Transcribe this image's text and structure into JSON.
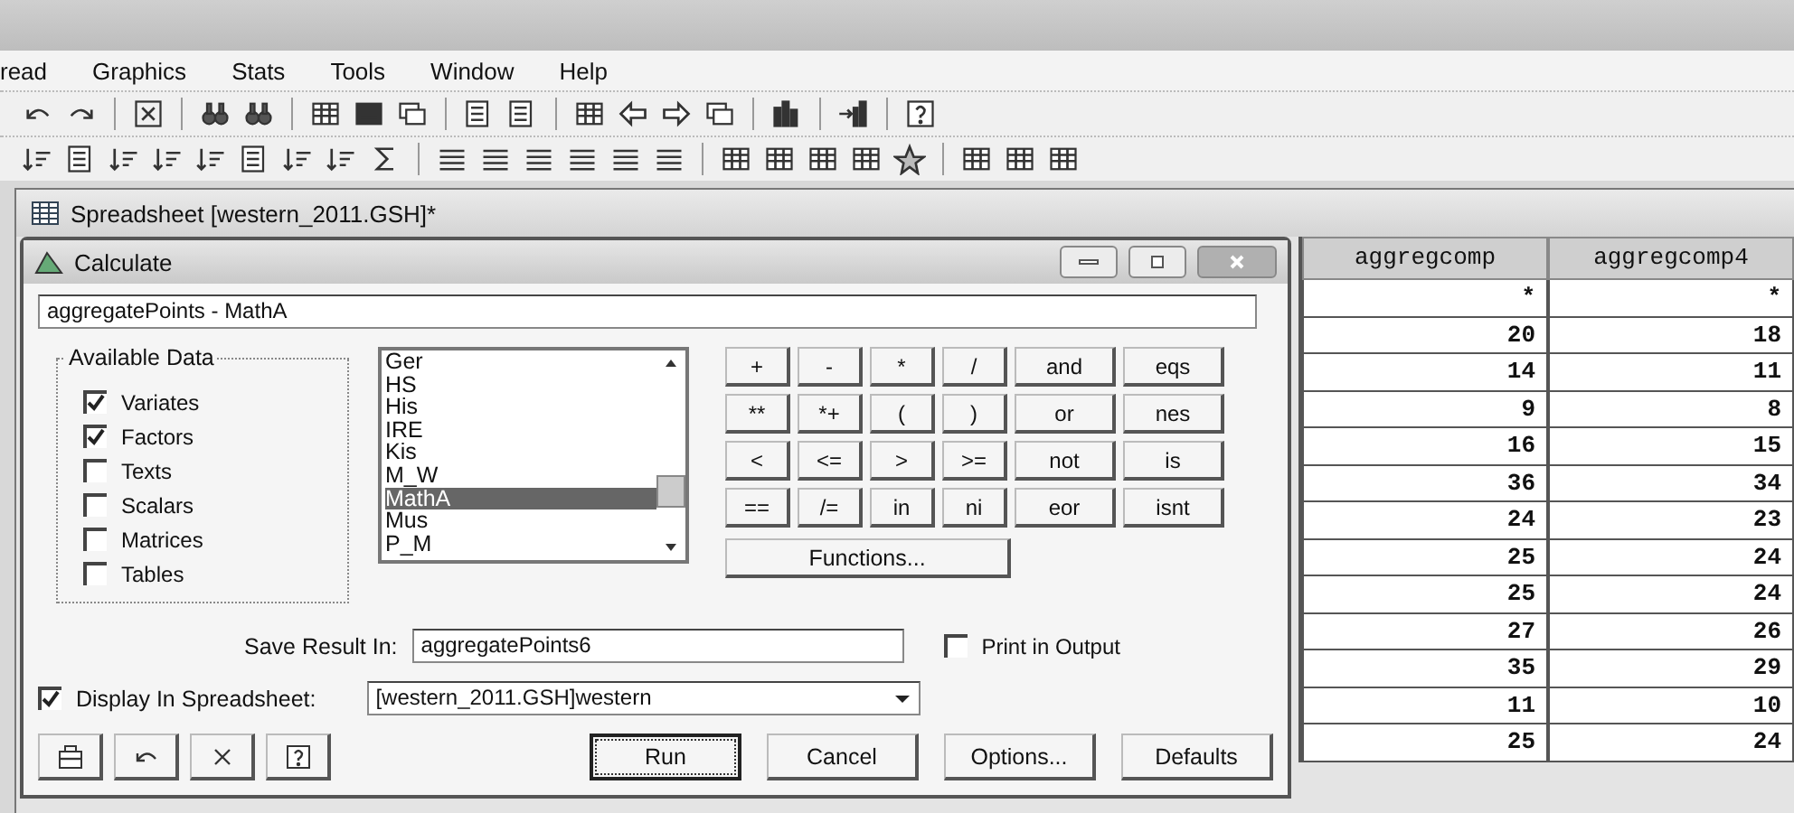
{
  "menu": [
    {
      "label": "read"
    },
    {
      "label": "Graphics"
    },
    {
      "label": "Stats"
    },
    {
      "label": "Tools"
    },
    {
      "label": "Window"
    },
    {
      "label": "Help"
    }
  ],
  "spreadsheet": {
    "title": "Spreadsheet [western_2011.GSH]*"
  },
  "dialog": {
    "title": "Calculate",
    "expression": "aggregatePoints - MathA",
    "available_data": {
      "title": "Available Data",
      "items": [
        {
          "label": "Variates",
          "checked": true
        },
        {
          "label": "Factors",
          "checked": true
        },
        {
          "label": "Texts",
          "checked": false
        },
        {
          "label": "Scalars",
          "checked": false
        },
        {
          "label": "Matrices",
          "checked": false
        },
        {
          "label": "Tables",
          "checked": false
        }
      ]
    },
    "list": [
      {
        "label": "Ger",
        "selected": false
      },
      {
        "label": "HS",
        "selected": false
      },
      {
        "label": "His",
        "selected": false
      },
      {
        "label": "IRE",
        "selected": false
      },
      {
        "label": "Kis",
        "selected": false
      },
      {
        "label": "M_W",
        "selected": false
      },
      {
        "label": "MathA",
        "selected": true
      },
      {
        "label": "Mus",
        "selected": false
      },
      {
        "label": "P_M",
        "selected": false
      }
    ],
    "operators": [
      [
        "+",
        "-",
        "*",
        "/",
        "and",
        "eqs"
      ],
      [
        "**",
        "*+",
        "(",
        ")",
        "or",
        "nes"
      ],
      [
        "<",
        "<=",
        ">",
        ">=",
        "not",
        "is"
      ],
      [
        "==",
        "/=",
        "in",
        "ni",
        "eor",
        "isnt"
      ]
    ],
    "functions_button": "Functions...",
    "save_label": "Save Result In:",
    "save_value": "aggregatePoints6",
    "print_output": {
      "label": "Print in Output",
      "checked": false
    },
    "display": {
      "label": "Display In Spreadsheet:",
      "checked": true,
      "value": "[western_2011.GSH]western"
    },
    "buttons": [
      {
        "label": "Run",
        "focused": true
      },
      {
        "label": "Cancel",
        "focused": false
      },
      {
        "label": "Options...",
        "focused": false
      },
      {
        "label": "Defaults",
        "focused": false
      }
    ]
  },
  "table": {
    "columns": [
      "aggregcomp",
      "aggregcomp4"
    ],
    "rows": [
      [
        "*",
        "*"
      ],
      [
        "20",
        "18"
      ],
      [
        "14",
        "11"
      ],
      [
        "9",
        "8"
      ],
      [
        "16",
        "15"
      ],
      [
        "36",
        "34"
      ],
      [
        "24",
        "23"
      ],
      [
        "25",
        "24"
      ],
      [
        "25",
        "24"
      ],
      [
        "27",
        "26"
      ],
      [
        "35",
        "29"
      ],
      [
        "11",
        "10"
      ],
      [
        "25",
        "24"
      ]
    ]
  }
}
